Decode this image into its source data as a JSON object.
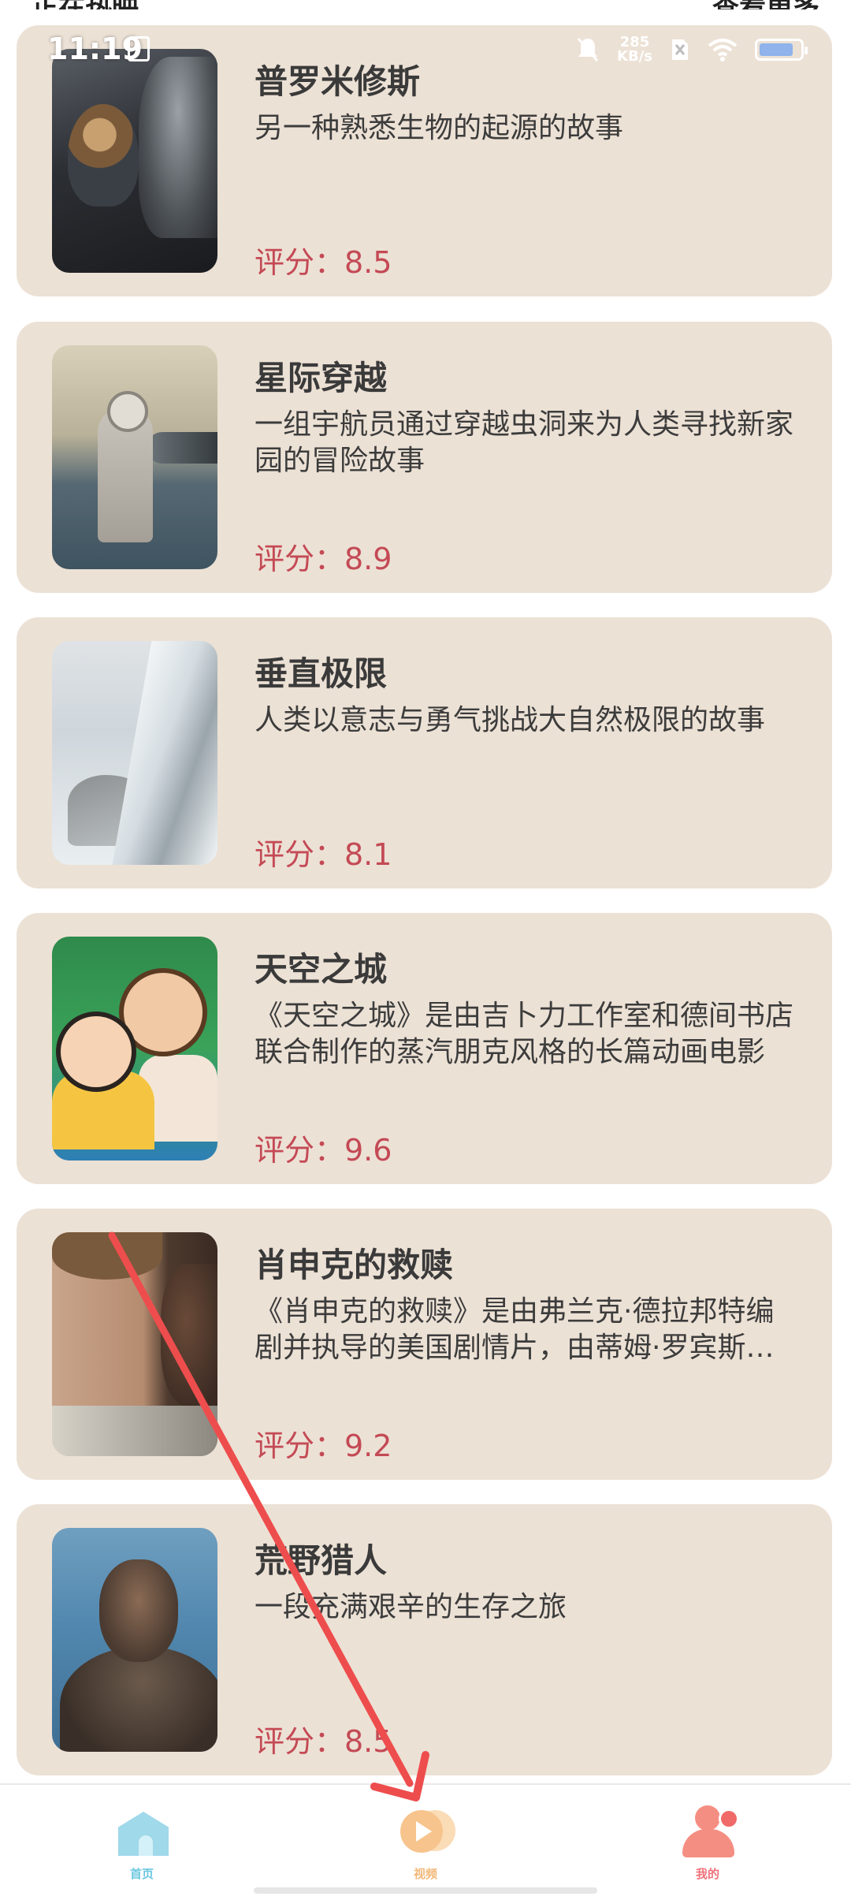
{
  "status_bar": {
    "time": "11:19",
    "net_speed_value": "285",
    "net_speed_unit": "KB/s",
    "battery_level": 0.85
  },
  "header": {
    "left_partial": "正在热映",
    "right_partial": "查看更多"
  },
  "movies": [
    {
      "title": "普罗米修斯",
      "desc": "另一种熟悉生物的起源的故事",
      "rating": "评分：8.5",
      "poster_icon": "prometheus-poster"
    },
    {
      "title": "星际穿越",
      "desc": "一组宇航员通过穿越虫洞来为人类寻找新家园的冒险故事",
      "rating": "评分：8.9",
      "poster_icon": "interstellar-poster"
    },
    {
      "title": "垂直极限",
      "desc": "人类以意志与勇气挑战大自然极限的故事",
      "rating": "评分：8.1",
      "poster_icon": "vertical-limit-poster"
    },
    {
      "title": "天空之城",
      "desc": "《天空之城》是由吉卜力工作室和德间书店联合制作的蒸汽朋克风格的长篇动画电影",
      "rating": "评分：9.6",
      "poster_icon": "laputa-poster"
    },
    {
      "title": "肖申克的救赎",
      "desc": "《肖申克的救赎》是由弗兰克·德拉邦特编剧并执导的美国剧情片，由蒂姆·罗宾斯等主演",
      "rating": "评分：9.2",
      "poster_icon": "shawshank-poster"
    },
    {
      "title": "荒野猎人",
      "desc": "一段充满艰辛的生存之旅",
      "rating": "评分：8.5",
      "poster_icon": "revenant-poster"
    }
  ],
  "bottom_nav": {
    "items": [
      {
        "label": "首页",
        "icon": "home-icon",
        "color": "#6cc7e0"
      },
      {
        "label": "视频",
        "icon": "video-icon",
        "color": "#f2b878"
      },
      {
        "label": "我的",
        "icon": "me-icon",
        "color": "#f0727a"
      }
    ]
  },
  "colors": {
    "card_background": "#ece1d5",
    "rating_text": "#c44a55",
    "annotation_arrow": "#ee4d4d"
  }
}
